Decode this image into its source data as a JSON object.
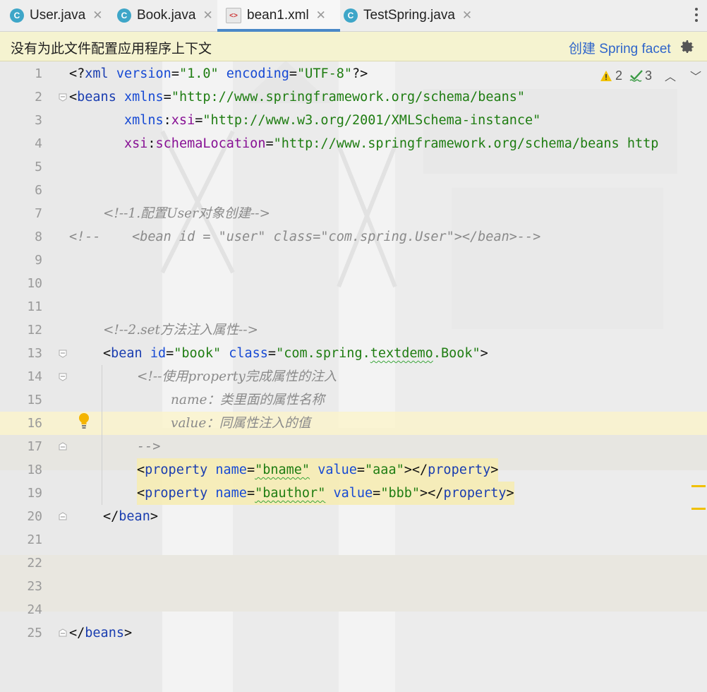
{
  "tabs": [
    {
      "label": "User.java",
      "icon": "java-class-icon",
      "active": false
    },
    {
      "label": "Book.java",
      "icon": "java-class-icon",
      "active": false
    },
    {
      "label": "bean1.xml",
      "icon": "xml-file-icon",
      "active": true
    },
    {
      "label": "TestSpring.java",
      "icon": "java-class-icon",
      "active": false
    }
  ],
  "notice": {
    "message": "没有为此文件配置应用程序上下文",
    "link": "创建 Spring facet"
  },
  "inspections": {
    "warnings": "2",
    "typos": "3"
  },
  "line_numbers": [
    "1",
    "2",
    "3",
    "4",
    "5",
    "6",
    "7",
    "8",
    "9",
    "10",
    "11",
    "12",
    "13",
    "14",
    "15",
    "16",
    "17",
    "18",
    "19",
    "20",
    "21",
    "22",
    "23",
    "24",
    "25"
  ],
  "code": {
    "l1_a": "<?",
    "l1_b": "xml",
    "l1_c": " version",
    "l1_d": "=",
    "l1_e": "\"1.0\"",
    "l1_f": " encoding",
    "l1_g": "=",
    "l1_h": "\"UTF-8\"",
    "l1_i": "?>",
    "l2_a": "<",
    "l2_b": "beans",
    "l2_c": " xmlns",
    "l2_d": "=",
    "l2_e": "\"http://www.springframework.org/schema/beans\"",
    "l3_a": "       xmlns",
    "l3_b": ":",
    "l3_c": "xsi",
    "l3_d": "=",
    "l3_e": "\"http://www.w3.org/2001/XMLSchema-instance\"",
    "l4_a": "       xsi",
    "l4_b": ":",
    "l4_c": "schemaLocation",
    "l4_d": "=",
    "l4_e": "\"http://www.springframework.org/schema/beans http",
    "l7": "<!--1.配置User对象创建-->",
    "l8": "<!--    <bean id = \"user\" class=\"com.spring.User\"></bean>-->",
    "l12": "<!--2.set方法注入属性-->",
    "l13_a": "<",
    "l13_b": "bean",
    "l13_c": " id",
    "l13_d": "=",
    "l13_e": "\"book\"",
    "l13_f": " class",
    "l13_g": "=",
    "l13_h": "\"com.spring.",
    "l13_i": "textdemo",
    "l13_j": ".Book\"",
    "l13_k": ">",
    "l14": "<!--使用property完成属性的注入",
    "l15": "name：类里面的属性名称",
    "l16": "value：同属性注入的值",
    "l17": "-->",
    "l18_a": "<",
    "l18_b": "property",
    "l18_c": " name",
    "l18_d": "=",
    "l18_e": "\"bname\"",
    "l18_f": " value",
    "l18_g": "=",
    "l18_h": "\"aaa\"",
    "l18_i": "></",
    "l18_j": "property",
    "l18_k": ">",
    "l19_a": "<",
    "l19_b": "property",
    "l19_c": " name",
    "l19_d": "=",
    "l19_e": "\"bauthor\"",
    "l19_f": " value",
    "l19_g": "=",
    "l19_h": "\"bbb\"",
    "l19_i": "></",
    "l19_j": "property",
    "l19_k": ">",
    "l20_a": "</",
    "l20_b": "bean",
    "l20_c": ">",
    "l25_a": "</",
    "l25_b": "beans",
    "l25_c": ">"
  }
}
